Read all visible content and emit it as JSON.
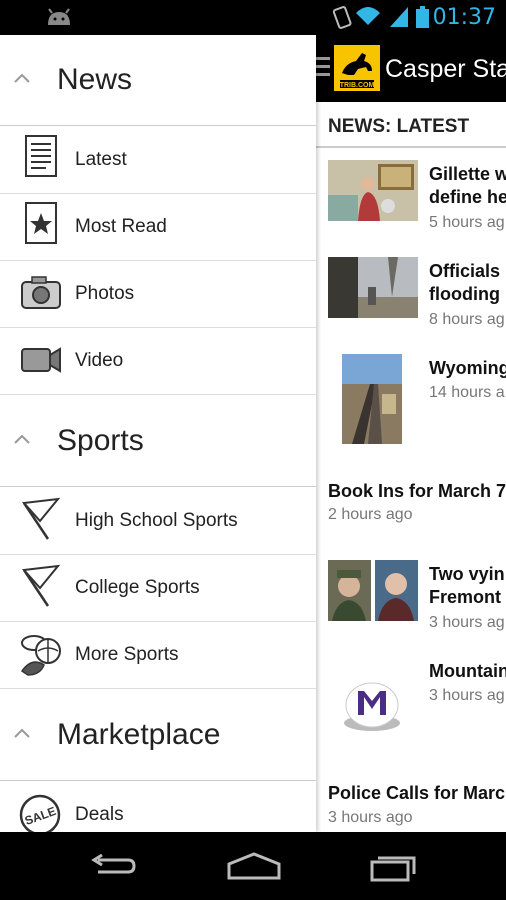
{
  "status": {
    "time": "01:37"
  },
  "app": {
    "title": "Casper Star-Tribune",
    "logo_text": "TRIB.COM"
  },
  "section": {
    "title": "NEWS: LATEST"
  },
  "stories": [
    {
      "title1": "Gillette w",
      "title2": "define he",
      "time": "5 hours ag"
    },
    {
      "title1": "Officials",
      "title2": "flooding",
      "time": "8 hours ag"
    },
    {
      "title1": "Wyoming",
      "title2": "",
      "time": "14 hours a"
    },
    {
      "title1": "Book Ins for March 7",
      "title2": "",
      "time": "2 hours ago"
    },
    {
      "title1": "Two vyin",
      "title2": "Fremont",
      "time": "3 hours ag"
    },
    {
      "title1": "Mountain",
      "title2": "",
      "time": "3 hours ag"
    },
    {
      "title1": "Police Calls for Marc",
      "title2": "",
      "time": "3 hours ago"
    }
  ],
  "drawer": {
    "groups": [
      {
        "label": "News",
        "items": [
          "Latest",
          "Most Read",
          "Photos",
          "Video"
        ]
      },
      {
        "label": "Sports",
        "items": [
          "High School Sports",
          "College Sports",
          "More Sports"
        ]
      },
      {
        "label": "Marketplace",
        "items": [
          "Deals"
        ]
      }
    ]
  },
  "icons": {
    "latest": "document-icon",
    "most_read": "star-document-icon",
    "photos": "camera-icon",
    "video": "video-camera-icon",
    "high_school": "pennant-icon",
    "college": "pennant-icon",
    "more_sports": "sports-balls-icon",
    "deals": "sale-tag-icon"
  },
  "colors": {
    "accent": "#33b5e5",
    "logo": "#f8c400"
  }
}
